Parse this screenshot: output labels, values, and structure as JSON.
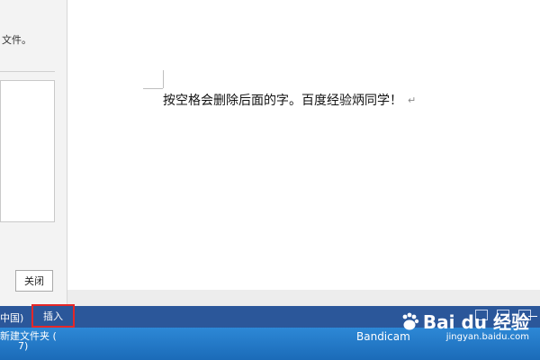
{
  "left_pane": {
    "top_text": "文件。",
    "close_button_label": "关闭"
  },
  "document": {
    "line_text": "按空格会删除后面的字。百度经验炳同学！",
    "paragraph_mark": "↵"
  },
  "status_bar": {
    "language_partial": "中国)",
    "insert_mode_label": "插入",
    "colors": {
      "bar": "#2b579a",
      "highlight_border": "#e52727"
    }
  },
  "taskbar": {
    "item_line1": "新建文件夹 (",
    "item_line2": "7)",
    "app_label": "Bandicam"
  },
  "watermark": {
    "brand": "Bai du 经验",
    "url": "jingyan.baidu.com",
    "icon": "baidu-paw-icon"
  }
}
